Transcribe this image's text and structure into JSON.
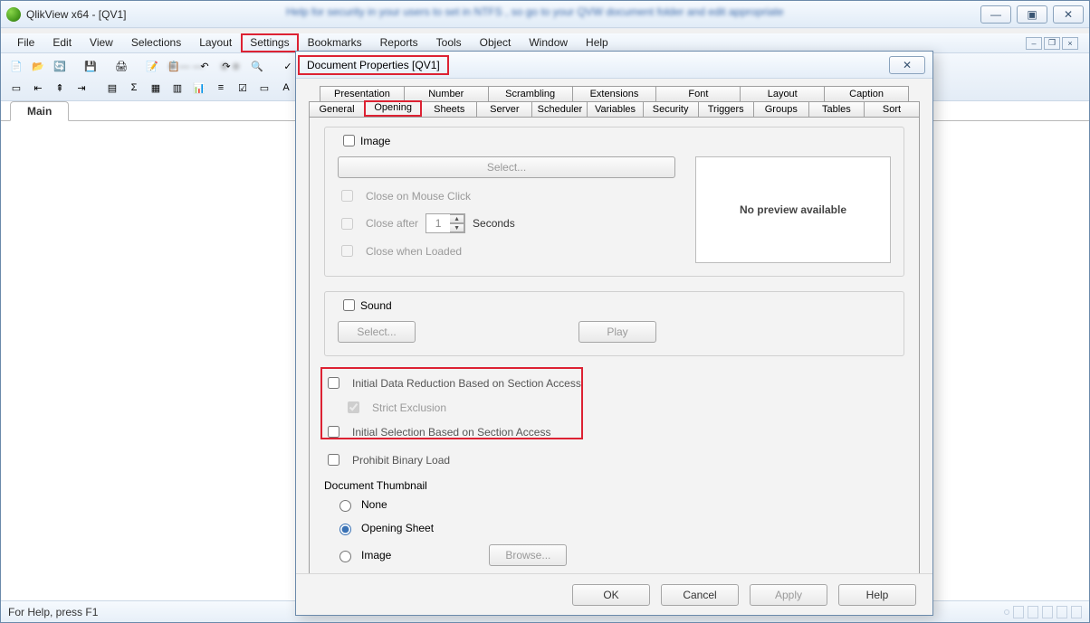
{
  "app": {
    "title": "QlikView x64 - [QV1]"
  },
  "menubar": {
    "file": "File",
    "edit": "Edit",
    "view": "View",
    "selections": "Selections",
    "layout": "Layout",
    "settings": "Settings",
    "bookmarks": "Bookmarks",
    "reports": "Reports",
    "tools": "Tools",
    "object": "Object",
    "window": "Window",
    "help": "Help"
  },
  "main_tab": "Main",
  "statusbar": {
    "text": "For Help, press F1"
  },
  "dialog": {
    "title": "Document Properties [QV1]",
    "tabs_row1": {
      "presentation": "Presentation",
      "number": "Number",
      "scrambling": "Scrambling",
      "extensions": "Extensions",
      "font": "Font",
      "layout": "Layout",
      "caption": "Caption"
    },
    "tabs_row2": {
      "general": "General",
      "opening": "Opening",
      "sheets": "Sheets",
      "server": "Server",
      "scheduler": "Scheduler",
      "variables": "Variables",
      "security": "Security",
      "triggers": "Triggers",
      "groups": "Groups",
      "tables": "Tables",
      "sort": "Sort"
    },
    "image_group": {
      "caption": "Image",
      "select_btn": "Select...",
      "close_click": "Close on Mouse Click",
      "close_after": "Close after",
      "close_after_val": "1",
      "seconds": "Seconds",
      "close_loaded": "Close when Loaded",
      "no_preview": "No preview available"
    },
    "sound_group": {
      "caption": "Sound",
      "select_btn": "Select...",
      "play_btn": "Play"
    },
    "section_access": {
      "initial_reduction": "Initial Data Reduction Based on Section Access",
      "strict_exclusion": "Strict Exclusion",
      "initial_selection": "Initial Selection Based on Section Access"
    },
    "prohibit_binary": "Prohibit Binary Load",
    "thumbnail": {
      "label": "Document Thumbnail",
      "none": "None",
      "opening_sheet": "Opening Sheet",
      "image": "Image",
      "browse": "Browse..."
    },
    "footer": {
      "ok": "OK",
      "cancel": "Cancel",
      "apply": "Apply",
      "help": "Help"
    }
  }
}
